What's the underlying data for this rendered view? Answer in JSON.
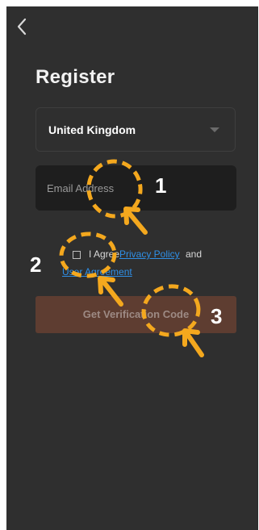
{
  "header": {
    "back_icon": "chevron-left-icon",
    "title": "Register"
  },
  "country": {
    "value": "United Kingdom",
    "icon": "chevron-down-icon"
  },
  "email": {
    "placeholder": "Email Address",
    "value": ""
  },
  "agreement": {
    "prefix": "I Agree",
    "privacy_link": "Privacy Policy",
    "conjunction": "and",
    "user_link": "User Agreement",
    "checked": false
  },
  "verify_button": {
    "label": "Get Verification Code",
    "enabled": false
  },
  "annotations": {
    "step1": "1",
    "step2": "2",
    "step3": "3",
    "color": "#f4a81e"
  },
  "colors": {
    "background": "#2f2f2f",
    "input_background": "#1e1e1e",
    "link": "#2f8fe6",
    "button": "#5e3d31"
  }
}
